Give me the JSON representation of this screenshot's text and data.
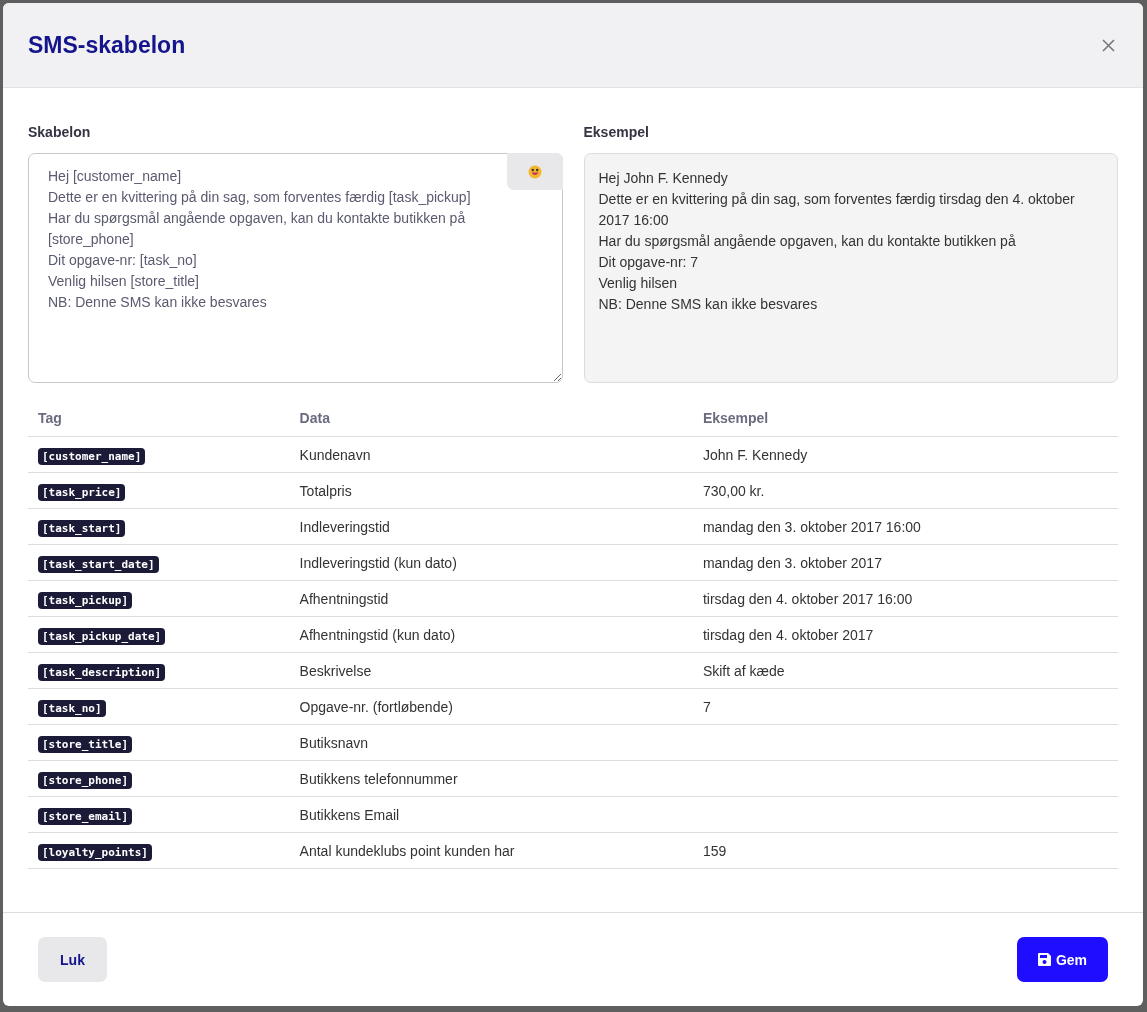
{
  "dialog": {
    "title": "SMS-skabelon"
  },
  "template": {
    "label": "Skabelon",
    "value": "Hej [customer_name]\nDette er en kvittering på din sag, som forventes færdig [task_pickup]\nHar du spørgsmål angående opgaven, kan du kontakte butikken på [store_phone]\nDit opgave-nr: [task_no]\nVenlig hilsen [store_title]\nNB: Denne SMS kan ikke besvares"
  },
  "example": {
    "label": "Eksempel",
    "lines": [
      "Hej John F. Kennedy",
      "Dette er en kvittering på din sag, som forventes færdig tirsdag den 4. oktober 2017 16:00",
      "Har du spørgsmål angående opgaven, kan du kontakte butikken på",
      "Dit opgave-nr: 7",
      "Venlig hilsen",
      "NB: Denne SMS kan ikke besvares"
    ]
  },
  "table": {
    "columns": [
      "Tag",
      "Data",
      "Eksempel"
    ],
    "rows": [
      {
        "tag": "[customer_name]",
        "data": "Kundenavn",
        "example": "John F. Kennedy"
      },
      {
        "tag": "[task_price]",
        "data": "Totalpris",
        "example": "730,00 kr."
      },
      {
        "tag": "[task_start]",
        "data": "Indleveringstid",
        "example": "mandag den 3. oktober 2017 16:00"
      },
      {
        "tag": "[task_start_date]",
        "data": "Indleveringstid (kun dato)",
        "example": "mandag den 3. oktober 2017"
      },
      {
        "tag": "[task_pickup]",
        "data": "Afhentningstid",
        "example": "tirsdag den 4. oktober 2017 16:00"
      },
      {
        "tag": "[task_pickup_date]",
        "data": "Afhentningstid (kun dato)",
        "example": "tirsdag den 4. oktober 2017"
      },
      {
        "tag": "[task_description]",
        "data": "Beskrivelse",
        "example": "Skift af kæde"
      },
      {
        "tag": "[task_no]",
        "data": "Opgave-nr. (fortløbende)",
        "example": "7"
      },
      {
        "tag": "[store_title]",
        "data": "Butiksnavn"
      },
      {
        "tag": "[store_phone]",
        "data": "Butikkens telefonnummer"
      },
      {
        "tag": "[store_email]",
        "data": "Butikkens Email"
      },
      {
        "tag": "[loyalty_points]",
        "data": "Antal kundeklubs point kunden har",
        "example": "159"
      }
    ]
  },
  "buttons": {
    "close": "Luk",
    "save": "Gem"
  }
}
